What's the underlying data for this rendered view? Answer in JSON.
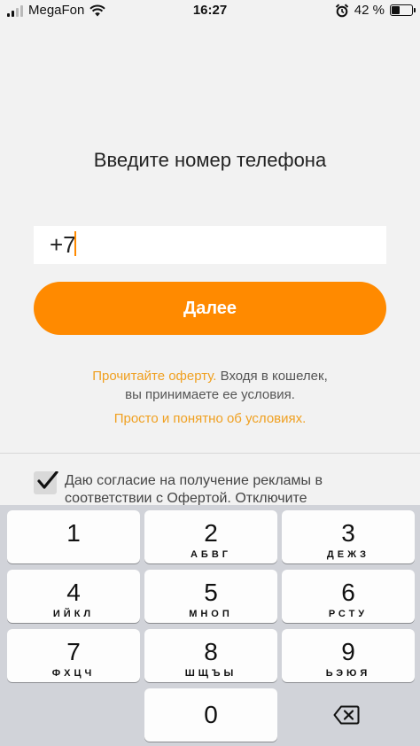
{
  "status_bar": {
    "carrier": "MegaFon",
    "time": "16:27",
    "battery": "42 %",
    "battery_level": 0.42,
    "icons": [
      "signal-icon",
      "wifi-icon",
      "alarm-icon",
      "battery-icon"
    ]
  },
  "screen": {
    "title": "Введите номер телефона",
    "phone_input_value": "+7",
    "next_button_label": "Далее",
    "offer_link": "Прочитайте оферту.",
    "offer_text_1": " Входя в кошелек,",
    "offer_text_2": "вы принимаете ее условия.",
    "terms_link": "Просто и понятно об условиях.",
    "consent_checked": true,
    "consent_text": "Даю согласие на получение рекламы в соответствии с Офертой. Отключите"
  },
  "keyboard": {
    "keys": [
      {
        "digit": "1",
        "letters": ""
      },
      {
        "digit": "2",
        "letters": "АБВГ"
      },
      {
        "digit": "3",
        "letters": "ДЕЖЗ"
      },
      {
        "digit": "4",
        "letters": "ИЙКЛ"
      },
      {
        "digit": "5",
        "letters": "МНОП"
      },
      {
        "digit": "6",
        "letters": "РСТУ"
      },
      {
        "digit": "7",
        "letters": "ФХЦЧ"
      },
      {
        "digit": "8",
        "letters": "ШЩЪЫ"
      },
      {
        "digit": "9",
        "letters": "ЬЭЮЯ"
      },
      {
        "digit": "0",
        "letters": ""
      }
    ],
    "backspace_icon": "backspace-icon"
  },
  "colors": {
    "accent": "#ff8a00",
    "link": "#f0a020",
    "background": "#f2f2f2",
    "keyboard_bg": "#d1d3d9"
  }
}
